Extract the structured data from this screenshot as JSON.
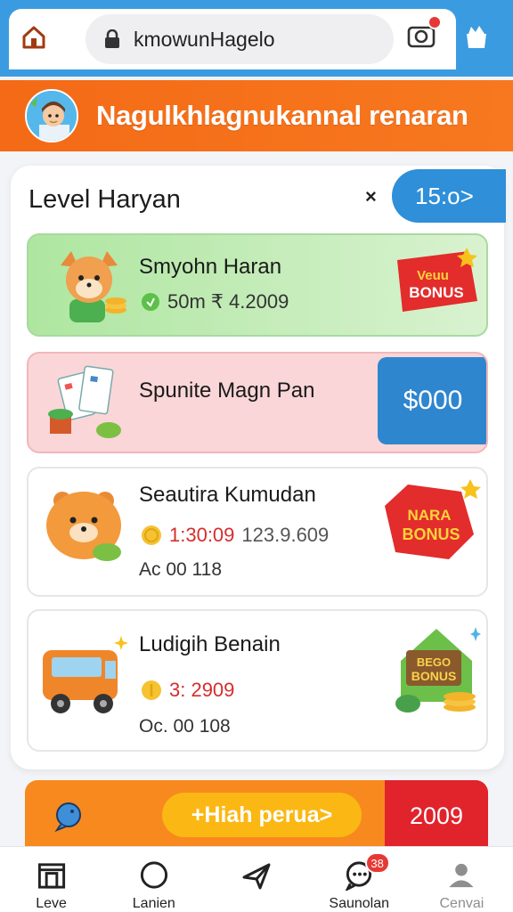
{
  "browser": {
    "url": "kmowunHagelo",
    "notification_dot": true
  },
  "header": {
    "title": "Nagulkhlagnukannal renaran"
  },
  "card": {
    "title": "Level Haryan",
    "close_label": "×",
    "timer_label": "15:o>"
  },
  "items": [
    {
      "name": "Smyohn Haran",
      "meta": "50m ₹ 4.2009",
      "badge_line1": "Veuu",
      "badge_line2": "BONUS"
    },
    {
      "name": "Spunite Magn Pan",
      "price": "$000"
    },
    {
      "name": "Seautira Kumudan",
      "meta_red": "1:30:09",
      "meta_gray": "123.9.609",
      "sub": "Ac 00 118",
      "badge_line1": "NARA",
      "badge_line2": "BONUS"
    },
    {
      "name": "Ludigih Benain",
      "meta_red": "3: 2909",
      "sub": "Oc. 00 108",
      "badge_line1": "BEGO",
      "badge_line2": "BONUS"
    }
  ],
  "promo": {
    "cta_label": "+Hiah perua>",
    "value": "2009"
  },
  "nav": {
    "items": [
      {
        "label": "Leve"
      },
      {
        "label": "Lanien"
      },
      {
        "label": ""
      },
      {
        "label": "Saunolan",
        "badge": "38"
      },
      {
        "label": "Cenvai"
      }
    ]
  },
  "colors": {
    "accent_blue": "#2f8fd8",
    "header_orange": "#f46a16",
    "bonus_red": "#e1232c",
    "cta_yellow": "#fbb713"
  }
}
